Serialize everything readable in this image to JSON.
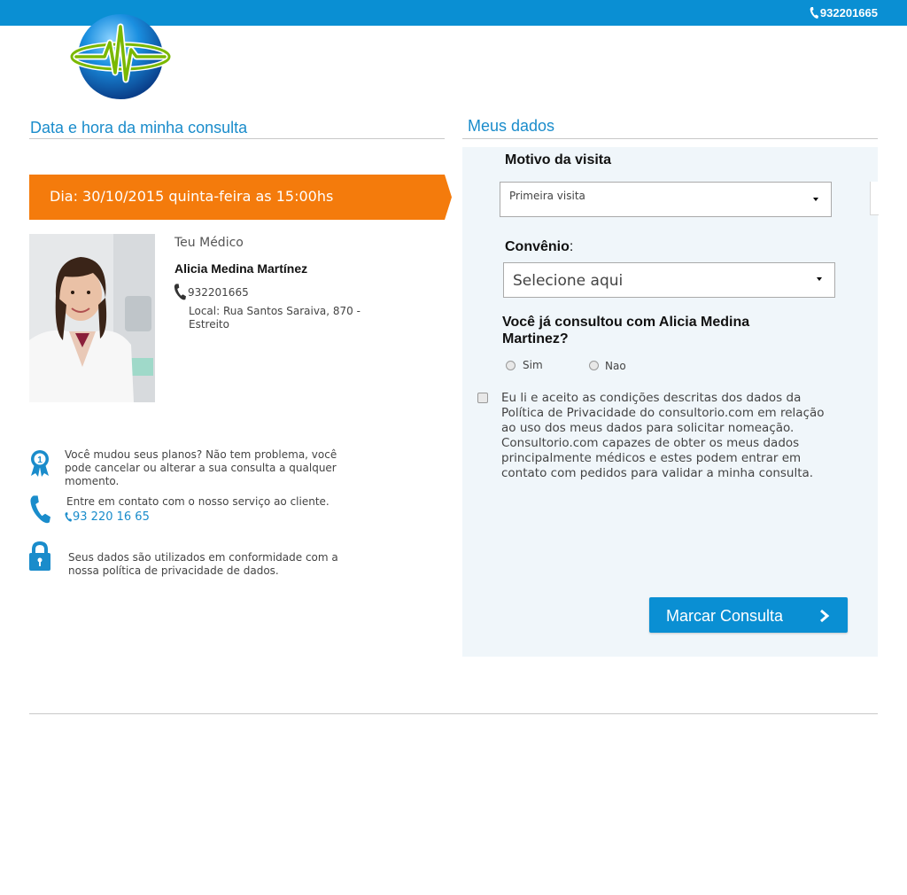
{
  "header": {
    "phone": "932201665"
  },
  "left": {
    "section_title": "Data e hora da minha consulta",
    "date_text": "Dia: 30/10/2015 quinta-feira as 15:00hs",
    "doctor": {
      "label": "Teu Médico",
      "name": "Alicia Medina Martínez",
      "phone": "932201665",
      "local": "Local: Rua Santos Saraiva, 870 - Estreito"
    },
    "info": {
      "plans_text": "Você mudou seus planos? Não tem problema, você pode cancelar ou alterar a sua consulta a qualquer momento.",
      "contact_text": "Entre em contato com o nosso serviço ao cliente.",
      "contact_phone": "93 220 16 65",
      "privacy_text": "Seus dados são utilizados em conformidade com a nossa política de privacidade de dados."
    }
  },
  "right": {
    "section_title": "Meus dados",
    "motivo_label": "Motivo da visita",
    "motivo_value": "Primeira visita",
    "convenio_label": "Convênio",
    "convenio_colon": ":",
    "convenio_value": "Selecione aqui",
    "question": "Você já consultou com Alicia Medina Martinez?",
    "option_yes": "Sim",
    "option_no": "Nao",
    "terms": "Eu li e aceito as condições descritas dos dados da Política de Privacidade do consultorio.com em relação ao uso dos meus dados para solicitar nomeação. Consultorio.com capazes de obter os meus dados principalmente médicos e estes podem entrar em contato com pedidos para validar a minha consulta.",
    "submit_label": "Marcar Consulta"
  },
  "colors": {
    "brand_blue": "#0a8fd3",
    "accent_orange": "#f47b0c",
    "title_blue": "#1a8ccb",
    "panel_bg": "#f0f6fa"
  }
}
